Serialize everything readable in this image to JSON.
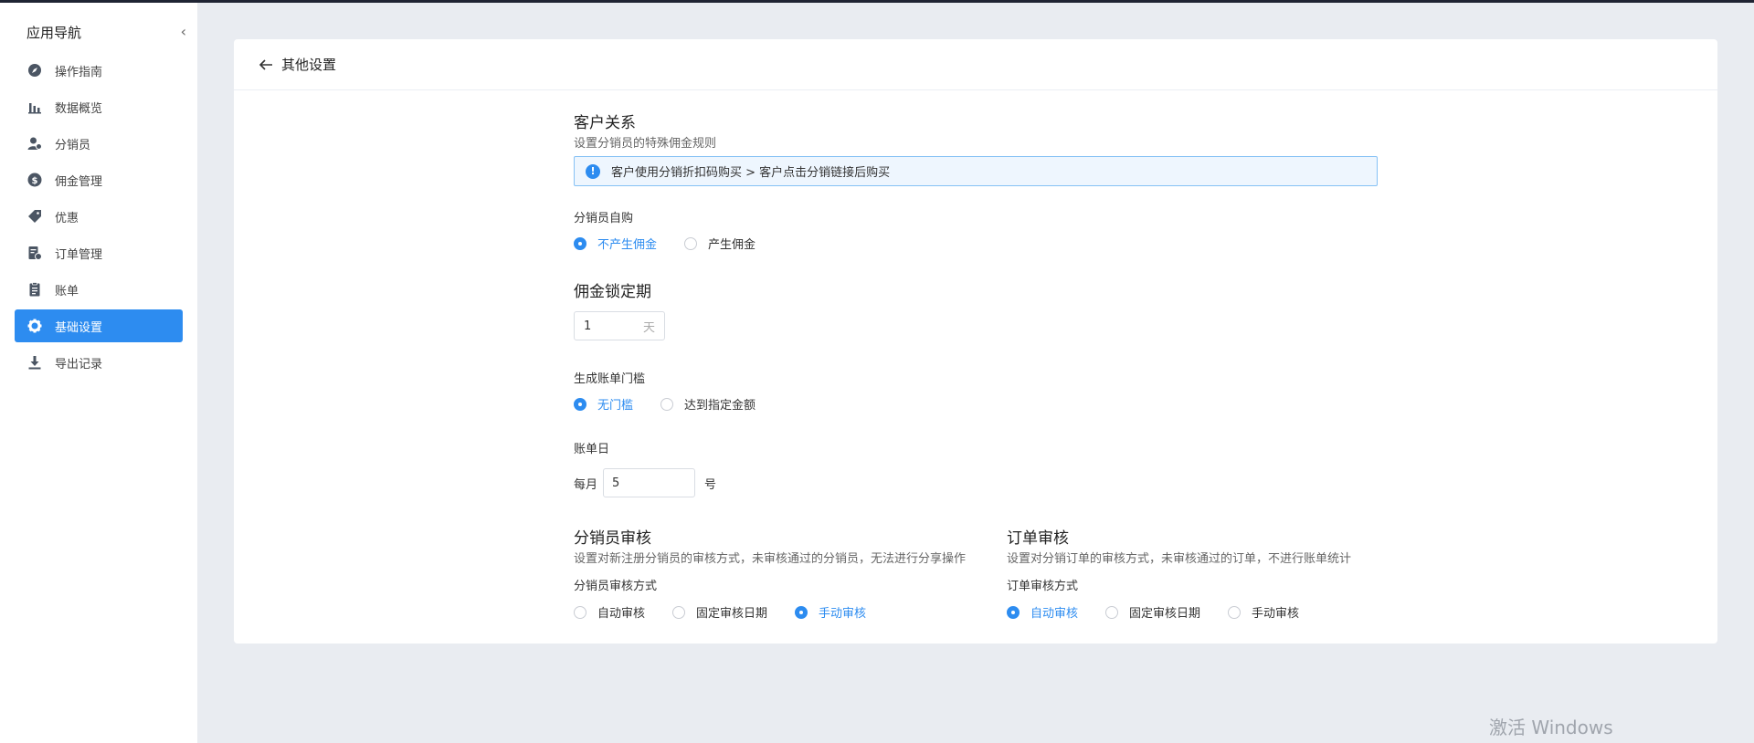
{
  "sidebar": {
    "title": "应用导航",
    "collapse_icon": "chevron-left-icon",
    "items": [
      {
        "label": "操作指南",
        "icon": "compass-icon",
        "active": false
      },
      {
        "label": "数据概览",
        "icon": "bar-chart-icon",
        "active": false
      },
      {
        "label": "分销员",
        "icon": "user-icon",
        "active": false
      },
      {
        "label": "佣金管理",
        "icon": "dollar-icon",
        "active": false
      },
      {
        "label": "优惠",
        "icon": "tag-icon",
        "active": false
      },
      {
        "label": "订单管理",
        "icon": "order-icon",
        "active": false
      },
      {
        "label": "账单",
        "icon": "bill-icon",
        "active": false
      },
      {
        "label": "基础设置",
        "icon": "gear-icon",
        "active": true
      },
      {
        "label": "导出记录",
        "icon": "download-icon",
        "active": false
      }
    ]
  },
  "header": {
    "title": "其他设置",
    "back_icon": "arrow-left-icon"
  },
  "customer": {
    "title": "客户关系",
    "subtitle": "设置分销员的特殊佣金规则",
    "alert": "客户使用分销折扣码购买 > 客户点击分销链接后购买"
  },
  "self_purchase": {
    "label": "分销员自购",
    "options": [
      "不产生佣金",
      "产生佣金"
    ],
    "selected": 0
  },
  "lock": {
    "title": "佣金锁定期",
    "value": "1",
    "suffix": "天"
  },
  "threshold": {
    "label": "生成账单门槛",
    "options": [
      "无门槛",
      "达到指定金额"
    ],
    "selected": 0
  },
  "bill_day": {
    "label": "账单日",
    "prefix": "每月",
    "value": "5",
    "suffix": "号"
  },
  "distributor_review": {
    "title": "分销员审核",
    "subtitle": "设置对新注册分销员的审核方式，未审核通过的分销员，无法进行分享操作",
    "label": "分销员审核方式",
    "options": [
      "自动审核",
      "固定审核日期",
      "手动审核"
    ],
    "selected": 2
  },
  "order_review": {
    "title": "订单审核",
    "subtitle": "设置对分销订单的审核方式，未审核通过的订单，不进行账单统计",
    "label": "订单审核方式",
    "options": [
      "自动审核",
      "固定审核日期",
      "手动审核"
    ],
    "selected": 0
  },
  "watermark": "激活 Windows",
  "colors": {
    "accent": "#2d8cf0",
    "background": "#e9ecf1",
    "topbar": "#1f2433"
  }
}
